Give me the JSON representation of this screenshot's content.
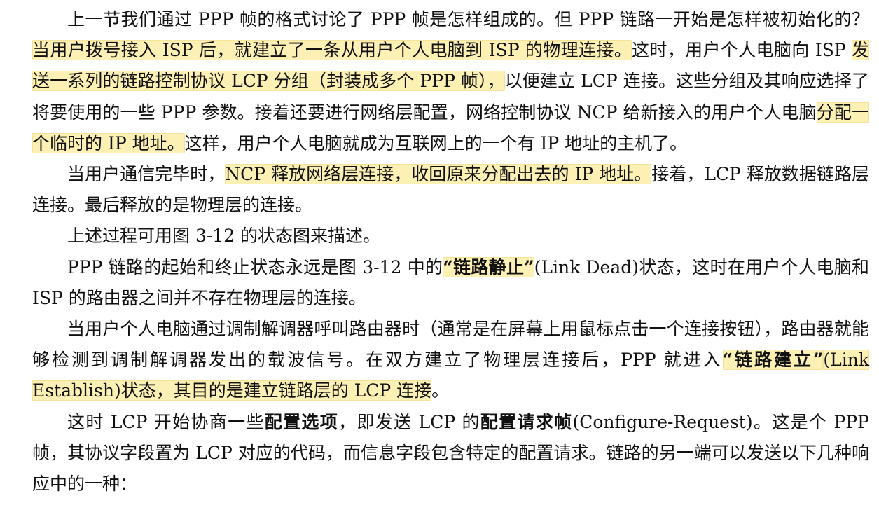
{
  "highlight_color": "#fdf0b4",
  "paragraphs": [
    {
      "segments": [
        {
          "text": "上一节我们通过 PPP 帧的格式讨论了 PPP 帧是怎样组成的。但 PPP 链路一开始是怎样被初始化的？",
          "style": "plain"
        },
        {
          "text": "当用户拨号接入 ISP 后，就建立了一条从用户个人电脑到 ISP 的物理连接。",
          "style": "highlight"
        },
        {
          "text": "这时，用户个人电脑向 ISP ",
          "style": "plain"
        },
        {
          "text": "发送一系列的链路控制协议 LCP 分组（封装成多个 PPP 帧），",
          "style": "highlight"
        },
        {
          "text": "以便建立 LCP 连接。这些分组及其响应选择了将要使用的一些 PPP 参数。接着还要进行网络层配置，网络控制协议 NCP 给新接入的用户个人电脑",
          "style": "plain"
        },
        {
          "text": "分配一个临时的 IP 地址。",
          "style": "highlight"
        },
        {
          "text": "这样，用户个人电脑就成为互联网上的一个有 IP 地址的主机了。",
          "style": "plain"
        }
      ]
    },
    {
      "segments": [
        {
          "text": "当用户通信完毕时，",
          "style": "plain"
        },
        {
          "text": "NCP 释放网络层连接，收回原来分配出去的 IP 地址。",
          "style": "highlight"
        },
        {
          "text": "接着，LCP 释放数据链路层连接。最后释放的是物理层的连接。",
          "style": "plain"
        }
      ]
    },
    {
      "segments": [
        {
          "text": "上述过程可用图 3-12 的状态图来描述。",
          "style": "plain"
        }
      ]
    },
    {
      "segments": [
        {
          "text": "PPP 链路的起始和终止状态永远是图 3-12 中的",
          "style": "plain"
        },
        {
          "text": "“链路静止”",
          "style": "highlight-bold"
        },
        {
          "text": "(Link Dead)状态，这时在用户个人电脑和 ISP 的路由器之间并不存在物理层的连接。",
          "style": "plain"
        }
      ]
    },
    {
      "segments": [
        {
          "text": "当用户个人电脑通过调制解调器呼叫路由器时（通常是在屏幕上用鼠标点击一个连接按钮），路由器就能够检测到调制解调器发出的载波信号。在双方建立了物理层连接后，PPP 就进入",
          "style": "plain"
        },
        {
          "text": "“链路建立”",
          "style": "highlight-bold"
        },
        {
          "text": "(Link Establish)状态，其目的是建立链路层的 LCP 连接",
          "style": "highlight"
        },
        {
          "text": "。",
          "style": "plain"
        }
      ]
    },
    {
      "segments": [
        {
          "text": "这时 LCP 开始协商一些",
          "style": "plain"
        },
        {
          "text": "配置选项",
          "style": "bold"
        },
        {
          "text": "，即发送 LCP 的",
          "style": "plain"
        },
        {
          "text": "配置请求帧",
          "style": "bold"
        },
        {
          "text": "(Configure-Request)。这是个 PPP 帧，其协议字段置为 LCP 对应的代码，而信息字段包含特定的配置请求。链路的另一端可以发送以下几种响应中的一种：",
          "style": "plain"
        }
      ]
    }
  ]
}
